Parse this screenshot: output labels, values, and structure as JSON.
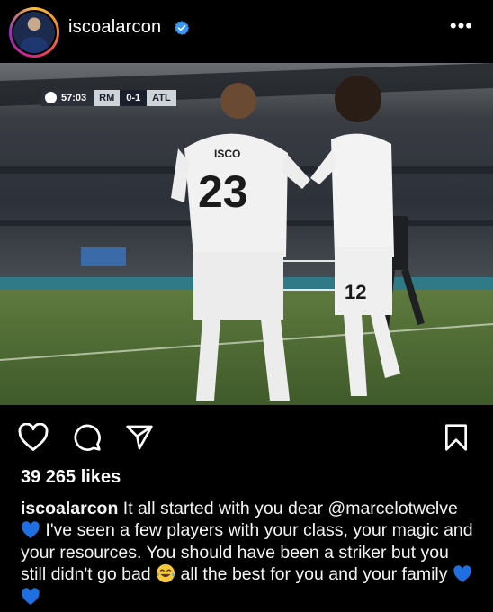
{
  "post": {
    "username": "iscoalarcon",
    "verified": true,
    "more_label": "•••",
    "likes_text": "39 265 likes",
    "caption": {
      "username": "iscoalarcon",
      "part1": " It all started with you dear ",
      "mention": "@marcelotwelve",
      "part2": " I've seen a few players with your class, your magic and your resources. You should have been a striker but you still didn't go bad ",
      "part3": " all the best for you and your family "
    }
  },
  "photo": {
    "scorebug": {
      "time": "57:03",
      "home": "RM",
      "score": "0-1",
      "away": "ATL"
    },
    "jersey_left_name": "ISCO",
    "jersey_left_number": "23",
    "jersey_right_number": "12"
  },
  "icons": {
    "verified": "verified-badge-icon",
    "like": "heart-icon",
    "comment": "comment-icon",
    "share": "send-icon",
    "save": "bookmark-icon",
    "emoji_heart": "blue-heart-emoji",
    "emoji_laugh": "tears-of-joy-emoji"
  },
  "colors": {
    "verified_blue": "#3897f0",
    "heart_blue": "#1f6fe0"
  }
}
